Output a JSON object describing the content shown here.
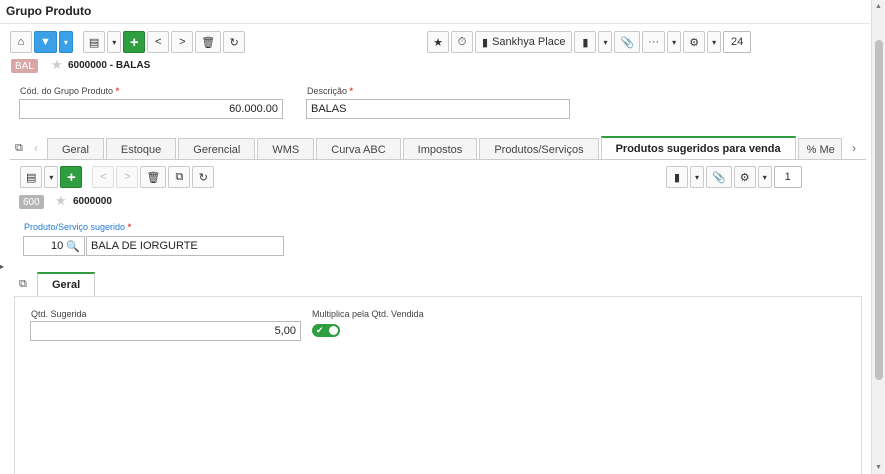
{
  "window": {
    "title": "Grupo Produto"
  },
  "main_toolbar": {
    "home_icon": "home-icon",
    "filter_icon": "filter-icon",
    "grid_icon": "grid-view-icon",
    "add_label": "+",
    "prev_label": "<",
    "next_label": ">",
    "trash_icon": "trash-icon",
    "refresh_icon": "refresh-icon",
    "favorite_icon": "star-icon",
    "timer_icon": "stopwatch-icon",
    "sankhya_place_label": "Sankhya Place",
    "doc_icon": "document-icon",
    "attach_icon": "paperclip-icon",
    "more_label": "···",
    "gear_icon": "gear-icon",
    "record_count": "24"
  },
  "record": {
    "badge": "BAL",
    "label": "6000000 - BALAS"
  },
  "form": {
    "cod_label": "Cód. do Grupo Produto",
    "cod_value": "60.000.00",
    "desc_label": "Descrição",
    "desc_value": "BALAS",
    "required_mark": "*"
  },
  "tabs": [
    {
      "label": "Geral"
    },
    {
      "label": "Estoque"
    },
    {
      "label": "Gerencial"
    },
    {
      "label": "WMS"
    },
    {
      "label": "Curva ABC"
    },
    {
      "label": "Impostos"
    },
    {
      "label": "Produtos/Serviços"
    },
    {
      "label": "Produtos sugeridos para venda",
      "active": true
    },
    {
      "label": "% Me"
    }
  ],
  "sub_toolbar": {
    "add_label": "+",
    "prev_label": "<",
    "next_label": ">",
    "record_count": "1"
  },
  "sub_record": {
    "badge": "600",
    "label": "6000000"
  },
  "sub_form": {
    "product_label": "Produto/Serviço sugerido",
    "product_code": "10",
    "product_name": "BALA DE IORGURTE",
    "required_mark": "*"
  },
  "inner_tabs": [
    {
      "label": "Geral",
      "active": true
    }
  ],
  "detail": {
    "qtd_label": "Qtd. Sugerida",
    "qtd_value": "5,00",
    "multiplica_label": "Multiplica pela Qtd. Vendida",
    "multiplica_on": true
  },
  "colors": {
    "accent_green": "#2e9e3f",
    "accent_blue": "#3aa0e8",
    "required_red": "#e24b3a"
  }
}
